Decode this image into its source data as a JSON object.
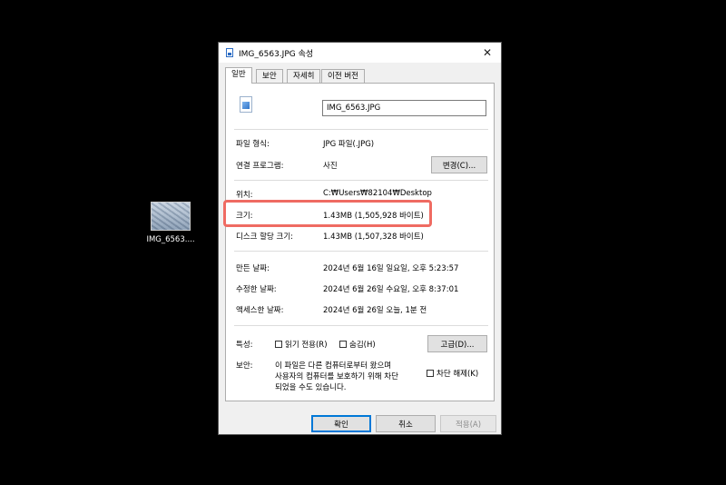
{
  "desktop": {
    "icon_label": "IMG_6563...."
  },
  "dialog": {
    "title": "IMG_6563.JPG 속성",
    "close": "✕",
    "tabs": [
      "일반",
      "보안",
      "자세히",
      "이전 버전"
    ],
    "filename": "IMG_6563.JPG",
    "file_type": {
      "label": "파일 형식:",
      "value": "JPG 파일(.JPG)"
    },
    "open_with": {
      "label": "연결 프로그램:",
      "value": "사진",
      "button": "변경(C)..."
    },
    "location": {
      "label": "위치:",
      "value": "C:₩Users₩82104₩Desktop"
    },
    "size": {
      "label": "크기:",
      "value": "1.43MB (1,505,928 바이트)"
    },
    "size_on_disk": {
      "label": "디스크 할당 크기:",
      "value": "1.43MB (1,507,328 바이트)"
    },
    "created": {
      "label": "만든 날짜:",
      "value": "2024년 6월 16일 일요일, 오후 5:23:57"
    },
    "modified": {
      "label": "수정한 날짜:",
      "value": "2024년 6월 26일 수요일, 오후 8:37:01"
    },
    "accessed": {
      "label": "액세스한 날짜:",
      "value": "2024년 6월 26일 오늘, 1분 전"
    },
    "attributes": {
      "label": "특성:",
      "readonly": "읽기 전용(R)",
      "hidden": "숨김(H)",
      "advanced": "고급(D)..."
    },
    "security": {
      "label": "보안:",
      "line1": "이 파일은 다른 컴퓨터로부터 왔으며",
      "line2": "사용자의 컴퓨터를 보호하기 위해 차단",
      "line3": "되었을 수도 있습니다.",
      "unblock": "차단 해제(K)"
    },
    "buttons": {
      "ok": "확인",
      "cancel": "취소",
      "apply": "적용(A)"
    }
  }
}
